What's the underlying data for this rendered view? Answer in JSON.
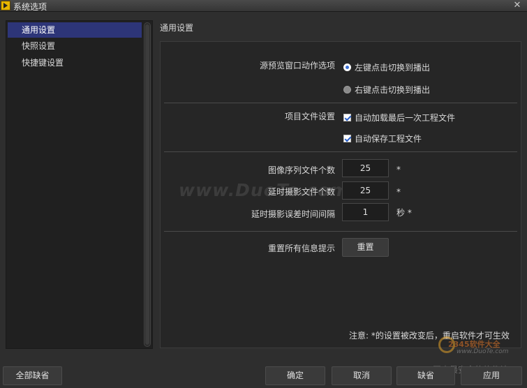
{
  "window": {
    "title": "系统选项",
    "close_glyph": "✕"
  },
  "nav": {
    "items": [
      {
        "label": "通用设置",
        "selected": true
      },
      {
        "label": "快照设置",
        "selected": false
      },
      {
        "label": "快捷键设置",
        "selected": false
      }
    ]
  },
  "section": {
    "title": "通用设置"
  },
  "general": {
    "source_preview_label": "源预览窗口动作选项",
    "radio_left": "左键点击切换到播出",
    "radio_right": "右键点击切换到播出",
    "radio_selected": "left",
    "project_file_label": "项目文件设置",
    "check_autoload": "自动加载最后一次工程文件",
    "check_autosave": "自动保存工程文件",
    "autoload_checked": true,
    "autosave_checked": true,
    "image_seq_label": "图像序列文件个数",
    "image_seq_value": "25",
    "image_seq_unit": "*",
    "timelapse_count_label": "延时摄影文件个数",
    "timelapse_count_value": "25",
    "timelapse_count_unit": "*",
    "timelapse_interval_label": "延时摄影误差时间间隔",
    "timelapse_interval_value": "1",
    "timelapse_interval_unit": "秒 *",
    "reset_label": "重置所有信息提示",
    "reset_button": "重置",
    "note": "注意: *的设置被改变后，重启软件才可生效"
  },
  "footer": {
    "defaults_all": "全部缺省",
    "ok": "确定",
    "cancel": "取消",
    "default": "缺省",
    "apply": "应用"
  },
  "watermarks": {
    "center": "www.DuoTe.com",
    "logo_line1": "2345软件大全",
    "logo_line2": "www.DuoTe.com",
    "logo_line3": "国内最安全的软件站"
  },
  "colors": {
    "selection": "#2d3578",
    "background": "#2e2e2e",
    "panel": "#262626"
  }
}
